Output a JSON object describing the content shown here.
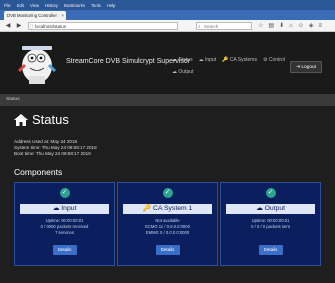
{
  "browser": {
    "menu": [
      "File",
      "Edit",
      "View",
      "History",
      "Bookmarks",
      "Tools",
      "Help"
    ],
    "tab_title": "DVB Monitoring Controller",
    "tab_close": "×",
    "new_tab": "+",
    "url": "localhost/status",
    "search_placeholder": "Search"
  },
  "header": {
    "brand": "StreamCore DVB Simulcrypt Supervisor",
    "nav": [
      {
        "icon": "☁",
        "label": "Status"
      },
      {
        "icon": "☁",
        "label": "Input"
      },
      {
        "icon": "🔑",
        "label": "CA Systems"
      },
      {
        "icon": "⚙",
        "label": "Control"
      }
    ],
    "nav2": {
      "icon": "☁",
      "label": "Output"
    },
    "logout_icon": "⇥",
    "logout_label": "Logout"
  },
  "breadcrumb": "Status",
  "page": {
    "title": "Status",
    "info": [
      "Address Used at: May 24 2018",
      "System time: Thu May 24 08:58:17 2018",
      "Boot time: Thu May 24 08:58:17 2018"
    ],
    "components_title": "Components"
  },
  "cards": [
    {
      "icon": "☁",
      "title": "Input",
      "lines": [
        "Uptime: 00:00:00:01",
        "0 / 0000 packets received",
        "7 services"
      ],
      "button": "Details"
    },
    {
      "icon": "🔑",
      "title": "CA System 1",
      "lines": [
        "Not available",
        "ECMG 11 / 0.0.0.0:0000",
        "EMMG 0 / 0.0.0.0:0000"
      ],
      "button": "Details"
    },
    {
      "icon": "☁",
      "title": "Output",
      "lines": [
        "Uptime: 00:00:00:01",
        "0 / 0 / 0 packets sent"
      ],
      "button": "Details"
    }
  ],
  "colors": {
    "accent": "#2ba38f",
    "card": "#0b1f5e",
    "button": "#3b6ec9"
  }
}
